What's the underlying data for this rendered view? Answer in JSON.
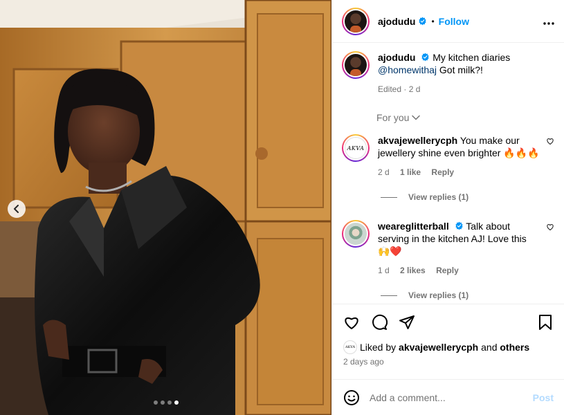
{
  "post": {
    "username": "ajodudu",
    "follow_label": "Follow",
    "separator": "•",
    "more_icon": "more-horizontal-icon",
    "caption_text": "My kitchen diaries",
    "caption_mention": "@homewithaj",
    "caption_tail": "Got milk?!",
    "edited": "Edited · 2 d",
    "sort_label": "For you"
  },
  "comments": [
    {
      "username": "akvajewellerycph",
      "avatar_text": "AKVA",
      "text": "You make our jewellery shine even brighter 🔥🔥🔥",
      "time": "2 d",
      "likes": "1 like",
      "reply": "Reply",
      "view_replies": "View replies (1)",
      "verified": false
    },
    {
      "username": "weareglitterball",
      "text": "Talk about serving in the kitchen AJ! Love this 🙌❤️",
      "time": "1 d",
      "likes": "2 likes",
      "reply": "Reply",
      "view_replies": "View replies (1)",
      "verified": true
    }
  ],
  "likes": {
    "prefix": "Liked by",
    "user": "akvajewellerycph",
    "and": "and",
    "others": "others",
    "mini_avatar_text": "AKVA"
  },
  "timestamp": "2 days ago",
  "add_comment": {
    "placeholder": "Add a comment...",
    "post_label": "Post"
  },
  "carousel": {
    "slides": 4,
    "active_index": 3
  },
  "colors": {
    "link_blue": "#0095f6",
    "verified_blue": "#0095f6",
    "heart_red": "#ed4956",
    "secondary_text": "#737373"
  }
}
